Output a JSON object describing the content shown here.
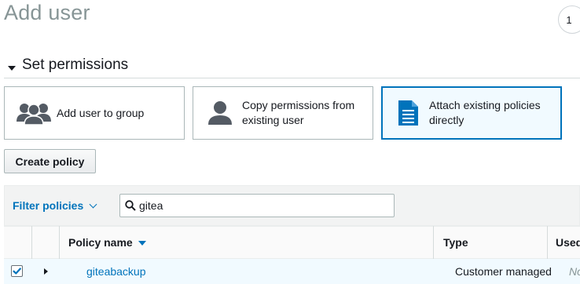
{
  "header": {
    "title": "Add user",
    "step": "1"
  },
  "permissions": {
    "section_title": "Set permissions",
    "options": [
      {
        "label_line1": "Add user to group",
        "label_line2": "",
        "icon": "users-group-icon"
      },
      {
        "label_line1": "Copy permissions from",
        "label_line2": "existing user",
        "icon": "user-icon"
      },
      {
        "label_line1": "Attach existing policies",
        "label_line2": "directly",
        "icon": "document-icon",
        "selected": true
      }
    ],
    "create_policy_label": "Create policy"
  },
  "filter": {
    "label": "Filter policies",
    "search_value": "gitea"
  },
  "table": {
    "columns": [
      "Policy name",
      "Type",
      "Used"
    ],
    "rows": [
      {
        "checked": true,
        "policy_name": "giteabackup",
        "type": "Customer managed",
        "used": "No"
      }
    ]
  },
  "colors": {
    "accent": "#0073bb",
    "selected_bg": "#f1faff",
    "icon_gray": "#545b64"
  }
}
